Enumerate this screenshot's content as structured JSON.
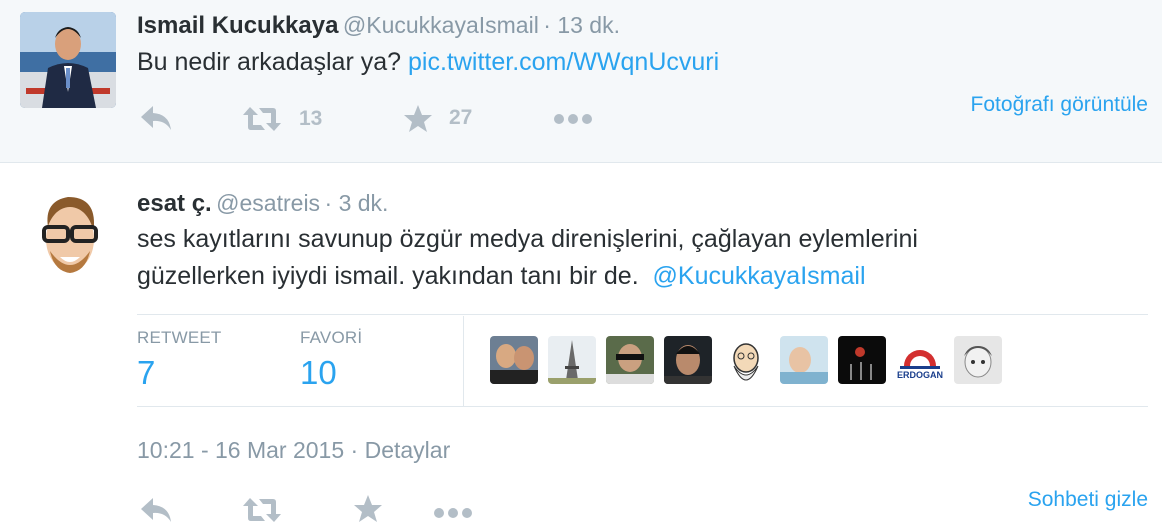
{
  "quoted_tweet": {
    "author_name": "Ismail Kucukkaya",
    "handle": "@KucukkayaIsmail",
    "time": "· 13 dk.",
    "text": "Bu nedir arkadaşlar ya?",
    "link": "pic.twitter.com/WWqnUcvuri",
    "retweet_count": "13",
    "favorite_count": "27",
    "view_photo": "Fotoğrafı görüntüle"
  },
  "main_tweet": {
    "author_name": "esat ç.",
    "handle": "@esatreis",
    "time": "· 3 dk.",
    "text_line1": "ses kayıtlarını savunup özgür medya direnişlerini, çağlayan eylemlerini",
    "text_line2": "güzellerken iyiydi ismail. yakından tanı bir de.",
    "mention": "@KucukkayaIsmail",
    "retweet_label": "RETWEET",
    "retweet_count": "7",
    "favorite_label": "FAVORİ",
    "favorite_count": "10",
    "favoriter_avatars": [
      "avatar-1",
      "avatar-2",
      "avatar-3",
      "avatar-4",
      "avatar-5",
      "avatar-6",
      "avatar-7",
      "avatar-8",
      "avatar-9"
    ],
    "erdogan_label": "ERDOGAN",
    "timestamp": "10:21 - 16 Mar 2015",
    "details_link": "Detaylar",
    "hide_conversation": "Sohbeti gizle"
  },
  "colors": {
    "link": "#2aa3ef",
    "muted": "#8899a6",
    "text": "#292f33",
    "icon": "#b3bec7"
  }
}
